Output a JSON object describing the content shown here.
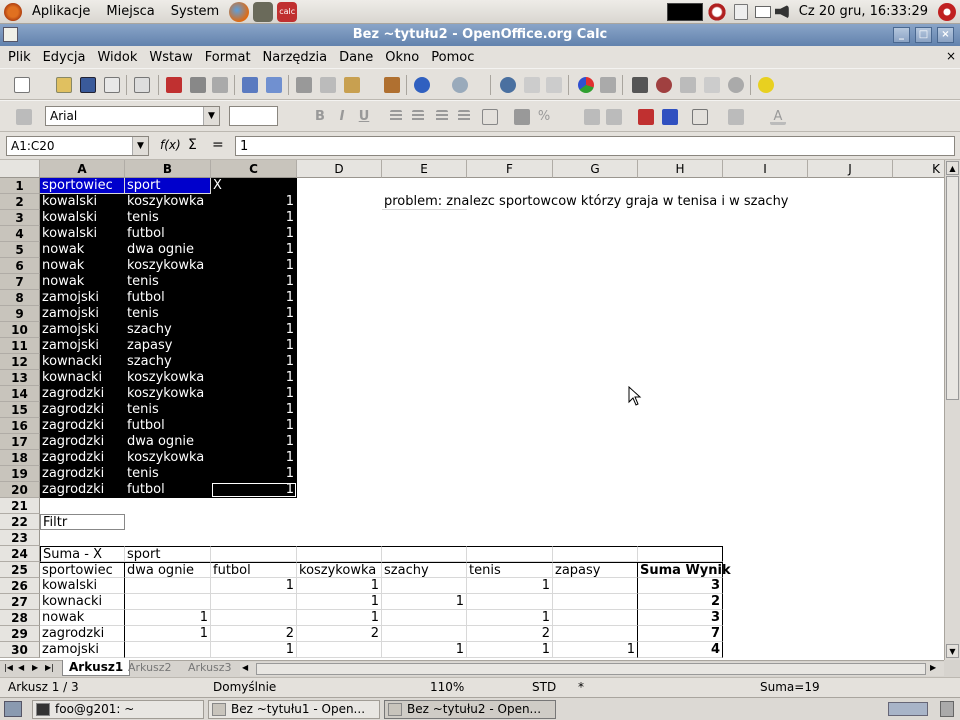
{
  "panel": {
    "menus": [
      "Aplikacje",
      "Miejsca",
      "System"
    ],
    "clock": "Cz 20 gru, 16:33:29"
  },
  "window": {
    "title": "Bez ~tytułu2 - OpenOffice.org Calc"
  },
  "menubar": [
    "Plik",
    "Edycja",
    "Widok",
    "Wstaw",
    "Format",
    "Narzędzia",
    "Dane",
    "Okno",
    "Pomoc"
  ],
  "format_toolbar": {
    "font_name": "Arial",
    "font_size": ""
  },
  "formula": {
    "namebox": "A1:C20",
    "fx": "f(x)",
    "sigma": "Σ",
    "equals": "=",
    "content": "1"
  },
  "columns": [
    "A",
    "B",
    "C",
    "D",
    "E",
    "F",
    "G",
    "H",
    "I",
    "J",
    "K"
  ],
  "rows": [
    "1",
    "2",
    "3",
    "4",
    "5",
    "6",
    "7",
    "8",
    "9",
    "10",
    "11",
    "12",
    "13",
    "14",
    "15",
    "16",
    "17",
    "18",
    "19",
    "20",
    "21",
    "22",
    "23",
    "24",
    "25",
    "26",
    "27",
    "28",
    "29",
    "30"
  ],
  "header_row": {
    "a": "sportowiec",
    "b": "sport",
    "c": "X"
  },
  "data_rows": [
    {
      "a": "kowalski",
      "b": "koszykowka",
      "c": "1"
    },
    {
      "a": "kowalski",
      "b": "tenis",
      "c": "1"
    },
    {
      "a": "kowalski",
      "b": "futbol",
      "c": "1"
    },
    {
      "a": "nowak",
      "b": "dwa ognie",
      "c": "1"
    },
    {
      "a": "nowak",
      "b": "koszykowka",
      "c": "1"
    },
    {
      "a": "nowak",
      "b": "tenis",
      "c": "1"
    },
    {
      "a": "zamojski",
      "b": "futbol",
      "c": "1"
    },
    {
      "a": "zamojski",
      "b": "tenis",
      "c": "1"
    },
    {
      "a": "zamojski",
      "b": "szachy",
      "c": "1"
    },
    {
      "a": "zamojski",
      "b": "zapasy",
      "c": "1"
    },
    {
      "a": "kownacki",
      "b": "szachy",
      "c": "1"
    },
    {
      "a": "kownacki",
      "b": "koszykowka",
      "c": "1"
    },
    {
      "a": "zagrodzki",
      "b": "koszykowka",
      "c": "1"
    },
    {
      "a": "zagrodzki",
      "b": "tenis",
      "c": "1"
    },
    {
      "a": "zagrodzki",
      "b": "futbol",
      "c": "1"
    },
    {
      "a": "zagrodzki",
      "b": "dwa ognie",
      "c": "1"
    },
    {
      "a": "zagrodzki",
      "b": "koszykowka",
      "c": "1"
    },
    {
      "a": "zagrodzki",
      "b": "tenis",
      "c": "1"
    },
    {
      "a": "zagrodzki",
      "b": "futbol",
      "c": "1"
    }
  ],
  "note": "problem: znalezc sportowcow którzy graja w tenisa i w szachy",
  "filter_label": "Filtr",
  "pivot": {
    "data_field": "Suma - X",
    "col_field": "sport",
    "header": [
      "sportowiec",
      "dwa ognie",
      "futbol",
      "koszykowka",
      "szachy",
      "tenis",
      "zapasy",
      "Suma Wynik"
    ],
    "rows": [
      [
        "kowalski",
        "",
        "1",
        "1",
        "",
        "1",
        "",
        "3"
      ],
      [
        "kownacki",
        "",
        "",
        "1",
        "1",
        "",
        "",
        "2"
      ],
      [
        "nowak",
        "1",
        "",
        "1",
        "",
        "1",
        "",
        "3"
      ],
      [
        "zagrodzki",
        "1",
        "2",
        "2",
        "",
        "2",
        "",
        "7"
      ],
      [
        "zamojski",
        "",
        "1",
        "",
        "1",
        "1",
        "1",
        "4"
      ]
    ]
  },
  "sheets": [
    "Arkusz1",
    "Arkusz2",
    "Arkusz3"
  ],
  "status": {
    "sheet": "Arkusz 1 / 3",
    "style": "Domyślnie",
    "zoom": "110%",
    "mode": "STD",
    "modified": "*",
    "sum": "Suma=19"
  },
  "taskbar": [
    {
      "label": "foo@g201: ~"
    },
    {
      "label": "Bez ~tytułu1 - Open..."
    },
    {
      "label": "Bez ~tytułu2 - Open..."
    }
  ]
}
